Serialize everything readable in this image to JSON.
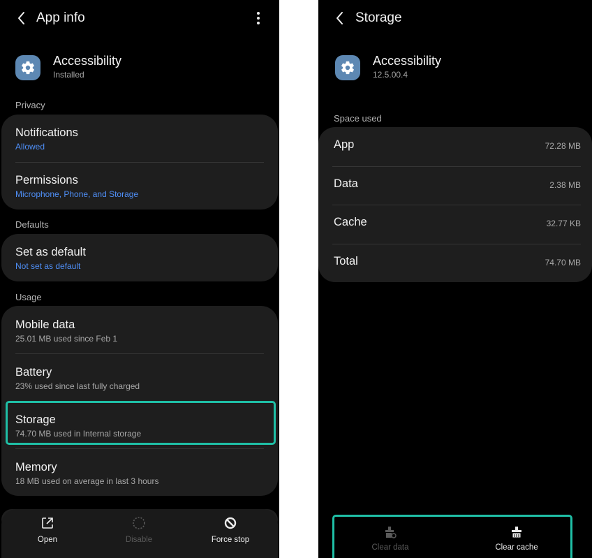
{
  "colors": {
    "background": "#000000",
    "card": "#1e1e1e",
    "accent_link": "#4f8ff7",
    "highlight": "#1fbfa6",
    "app_icon": "#5d88b3"
  },
  "left": {
    "header": {
      "title": "App info",
      "back_icon": "chevron-left-icon",
      "more_icon": "more-vertical-icon"
    },
    "app": {
      "name": "Accessibility",
      "status": "Installed",
      "icon": "gear-icon"
    },
    "privacy": {
      "label": "Privacy",
      "notifications": {
        "title": "Notifications",
        "sub": "Allowed"
      },
      "permissions": {
        "title": "Permissions",
        "sub": "Microphone, Phone, and Storage"
      }
    },
    "defaults": {
      "label": "Defaults",
      "set_default": {
        "title": "Set as default",
        "sub": "Not set as default"
      }
    },
    "usage": {
      "label": "Usage",
      "mobile_data": {
        "title": "Mobile data",
        "sub": "25.01 MB used since Feb 1"
      },
      "battery": {
        "title": "Battery",
        "sub": "23% used since last fully charged"
      },
      "storage": {
        "title": "Storage",
        "sub": "74.70 MB used in Internal storage"
      },
      "memory": {
        "title": "Memory",
        "sub": "18 MB used on average in last 3 hours"
      }
    },
    "bottom": {
      "open": {
        "label": "Open",
        "icon": "open-external-icon"
      },
      "disable": {
        "label": "Disable",
        "icon": "disable-circle-icon"
      },
      "force_stop": {
        "label": "Force stop",
        "icon": "force-stop-icon"
      }
    }
  },
  "right": {
    "header": {
      "title": "Storage",
      "back_icon": "chevron-left-icon"
    },
    "app": {
      "name": "Accessibility",
      "version": "12.5.00.4",
      "icon": "gear-icon"
    },
    "space_used_label": "Space used",
    "rows": [
      {
        "label": "App",
        "value": "72.28 MB"
      },
      {
        "label": "Data",
        "value": "2.38 MB"
      },
      {
        "label": "Cache",
        "value": "32.77 KB"
      },
      {
        "label": "Total",
        "value": "74.70 MB"
      }
    ],
    "actions": {
      "clear_data": {
        "label": "Clear data",
        "icon": "clear-data-icon"
      },
      "clear_cache": {
        "label": "Clear cache",
        "icon": "clear-cache-icon"
      }
    }
  }
}
